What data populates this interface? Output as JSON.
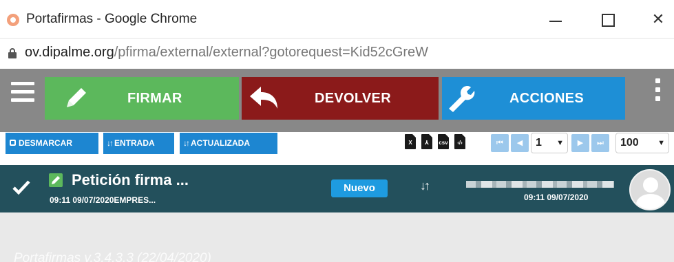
{
  "window": {
    "title": "Portafirmas - Google Chrome",
    "controls": {
      "minimize": "",
      "maximize": "",
      "close": "✕"
    }
  },
  "address_bar": {
    "host": "ov.dipalme.org",
    "path": "/pfirma/external/external?gotorequest=Kid52cGreW"
  },
  "toolbar": {
    "firmar_label": "FIRMAR",
    "devolver_label": "DEVOLVER",
    "acciones_label": "ACCIONES",
    "colors": {
      "firmar": "#5cb85c",
      "devolver": "#8b1a1a",
      "acciones": "#1e8fd6"
    }
  },
  "subtoolbar": {
    "desmarcar_label": "DESMARCAR",
    "entrada_label": "ENTRADA",
    "actualizada_label": "ACTUALIZADA",
    "file_icons": [
      "excel-icon",
      "pdf-icon",
      "csv-icon",
      "code-icon"
    ],
    "page_select": "1",
    "page_size_select": "100"
  },
  "request": {
    "title": "Petición firma ...",
    "subtitle": "09:11 09/07/2020EMPRES...",
    "status_badge": "Nuevo",
    "date": "09:11 09/07/2020"
  },
  "footer": {
    "version": "Portafirmas v.3.4.3.3 (22/04/2020)"
  }
}
